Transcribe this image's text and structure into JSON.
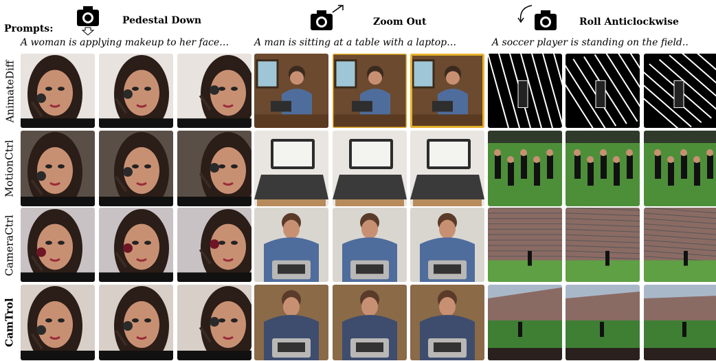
{
  "header": {
    "prompts_label": "Prompts:",
    "motions": [
      {
        "label": "Pedestal Down",
        "icon": "camera-pedestal-down-icon"
      },
      {
        "label": "Zoom Out",
        "icon": "camera-zoom-out-icon"
      },
      {
        "label": "Roll Anticlockwise",
        "icon": "camera-roll-anticlockwise-icon"
      }
    ],
    "prompts": [
      "A woman is applying makeup to her face…",
      "A man is sitting at a table with a laptop…",
      "A soccer player is standing on the field.."
    ]
  },
  "rows": [
    {
      "label": "AnimateDiff",
      "bold": false
    },
    {
      "label": "MotionCtrl",
      "bold": false
    },
    {
      "label": "CameraCtrl",
      "bold": false
    },
    {
      "label": "CamTrol",
      "bold": true
    }
  ],
  "colors": {
    "skin": "#c89073",
    "dark_hair": "#2b1d17",
    "shirt_blue": "#4f6d9c",
    "laptop_grey": "#b9b8b6",
    "grass_green": "#4d8f39",
    "crowd": "#8a6b64"
  }
}
